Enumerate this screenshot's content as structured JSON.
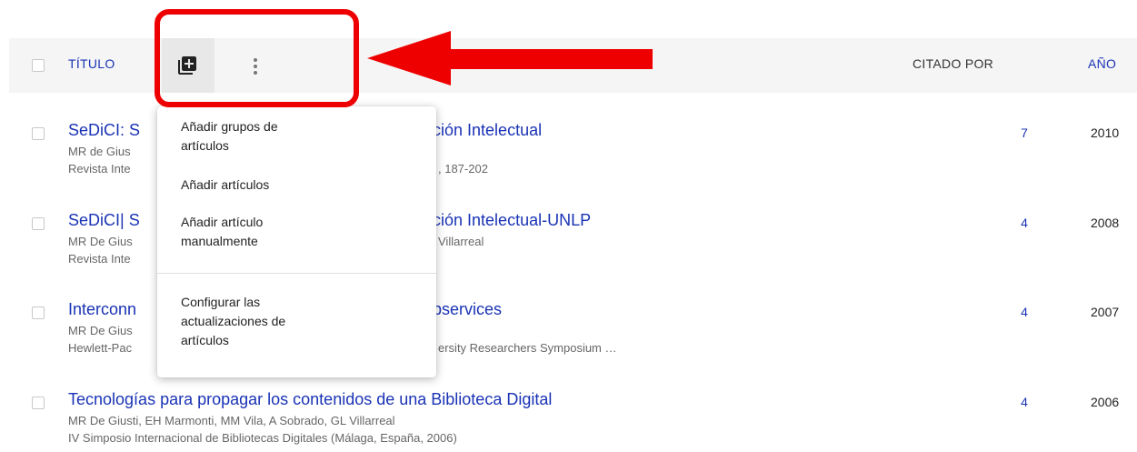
{
  "header": {
    "title_label": "TÍTULO",
    "cited_label": "CITADO POR",
    "year_label": "AÑO"
  },
  "icons": {
    "add": "add-library-icon",
    "more": "more-vert-icon",
    "arrow": "red-arrow-icon"
  },
  "colors": {
    "link": "#1a33b5",
    "annotation": "#ee0000",
    "header_bg": "#f5f5f5"
  },
  "menu": {
    "items": [
      "Añadir grupos de\nartículos",
      "Añadir artículos",
      "Añadir artículo\nmanualmente",
      "Configurar las\nactualizaciones de\nartículos"
    ]
  },
  "articles": [
    {
      "title_start": "SeDiCI: S",
      "title_end": "ación Intelectual",
      "authors": "MR de Gius",
      "venue_start": "Revista Inte",
      "venue_end": ", 187-202",
      "cited": "7",
      "year": "2010"
    },
    {
      "title_start": "SeDiCI| S",
      "title_end": "ación Intelectual-UNLP",
      "authors_start": "MR De Gius",
      "authors_end": "Villarreal",
      "venue_start": "Revista Inte",
      "cited": "4",
      "year": "2008"
    },
    {
      "title_start": "Interconn",
      "title_end": "ebservices",
      "authors_start": "MR De Gius",
      "venue_start": "Hewlett-Pac",
      "venue_end": "ersity Researchers Symposium …",
      "cited": "4",
      "year": "2007"
    },
    {
      "title": "Tecnologías para propagar los contenidos de una Biblioteca Digital",
      "authors": "MR De Giusti, EH Marmonti, MM Vila, A Sobrado, GL Villarreal",
      "venue": "IV Simposio Internacional de Bibliotecas Digitales (Málaga, España, 2006)",
      "cited": "4",
      "year": "2006"
    }
  ]
}
